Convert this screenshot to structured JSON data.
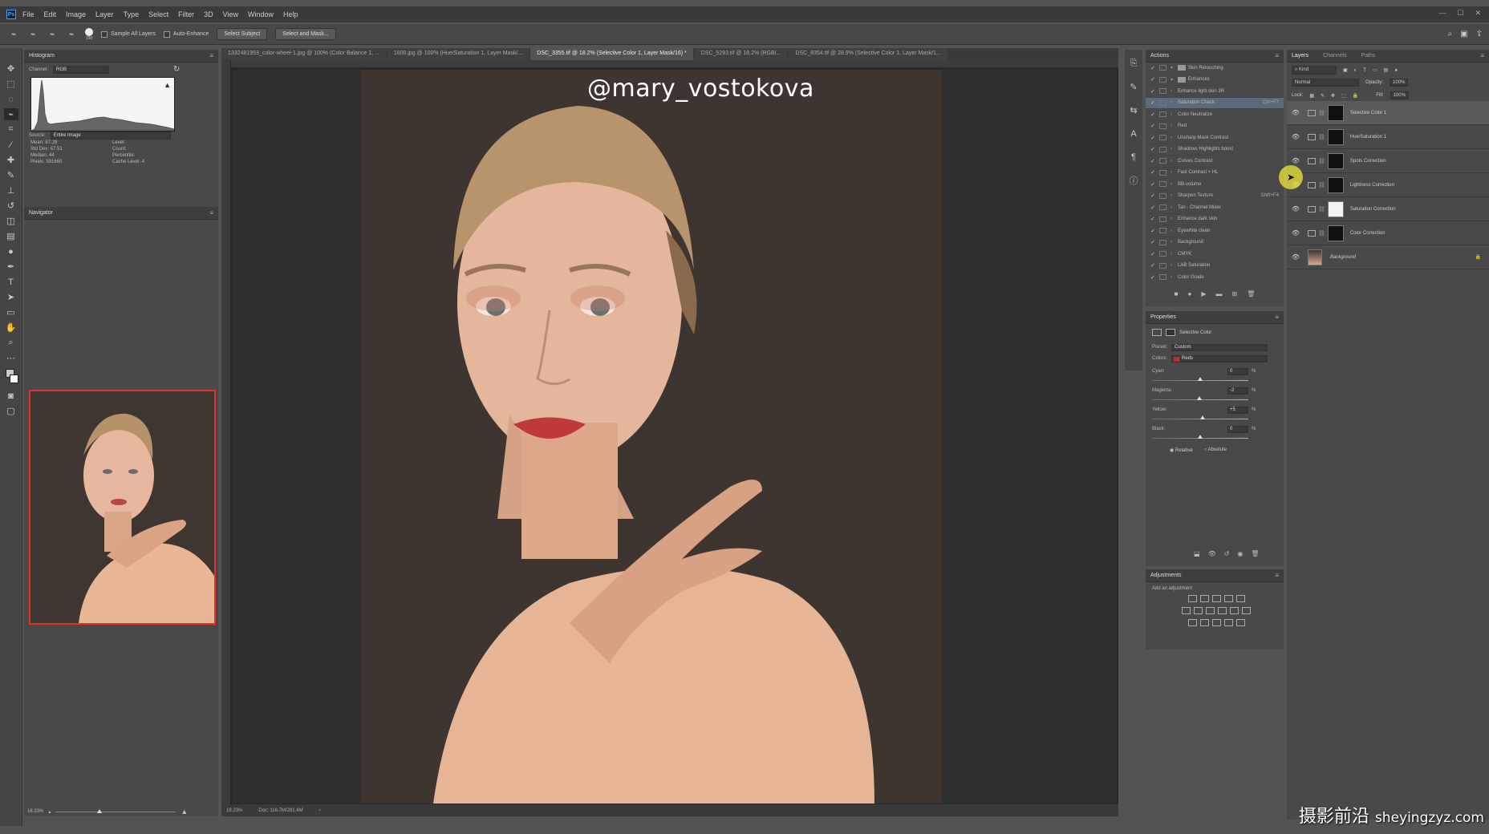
{
  "menubar": {
    "logo": "Ps",
    "items": [
      "File",
      "Edit",
      "Image",
      "Layer",
      "Type",
      "Select",
      "Filter",
      "3D",
      "View",
      "Window",
      "Help"
    ],
    "window_controls": [
      "—",
      "☐",
      "✕"
    ]
  },
  "options_bar": {
    "brush_size": "150",
    "sample_all_layers": "Sample All Layers",
    "auto_enhance": "Auto-Enhance",
    "select_subject": "Select Subject",
    "select_and_mask": "Select and Mask..."
  },
  "histogram": {
    "title": "Histogram",
    "channel_label": "Channel:",
    "channel_value": "RGB",
    "source_label": "Source:",
    "source_value": "Entire Image",
    "stats": [
      {
        "label": "Mean:",
        "value": "87.29"
      },
      {
        "label": "Std Dev:",
        "value": "67.51"
      },
      {
        "label": "Median:",
        "value": "44"
      },
      {
        "label": "Pixels:",
        "value": "591660"
      }
    ],
    "stats_right": [
      "Level:",
      "Count:",
      "Percentile:",
      "Cache Level: 4"
    ]
  },
  "navigator": {
    "title": "Navigator",
    "zoom": "18.23%"
  },
  "tabs": [
    {
      "label": "1332481953_color-wheel-1.jpg @ 100% (Color Balance 1, ...",
      "active": false
    },
    {
      "label": "1600.jpg @ 100% (Hue/Saturation 1, Layer Mask/...",
      "active": false
    },
    {
      "label": "DSC_3355.tif @ 18.2% (Selective Color 1, Layer Mask/16) *",
      "active": true
    },
    {
      "label": "DSC_5283.tif @ 18.2% (RGB/...",
      "active": false
    },
    {
      "label": "DSC_8354.tif @ 28.9% (Selective Color 1, Layer Mask/1...",
      "active": false
    }
  ],
  "canvas": {
    "watermark": "@mary_vostokova",
    "zoom": "18.23%",
    "doc_size": "Doc: 116.7M/281.4M"
  },
  "actions": {
    "title": "Actions",
    "items": [
      {
        "label": "Skin Retouching",
        "folder": true,
        "selected": false,
        "shortcut": ""
      },
      {
        "label": "Enhances",
        "folder": true,
        "selected": false,
        "shortcut": ""
      },
      {
        "label": "Enhance light skin 3R",
        "folder": false,
        "selected": false,
        "shortcut": ""
      },
      {
        "label": "Saturation Check",
        "folder": false,
        "selected": true,
        "shortcut": "Ctrl+F7"
      },
      {
        "label": "Color Neutralize",
        "folder": false,
        "selected": false,
        "shortcut": ""
      },
      {
        "label": "Red",
        "folder": false,
        "selected": false,
        "shortcut": ""
      },
      {
        "label": "Unsharp Mask Contrast",
        "folder": false,
        "selected": false,
        "shortcut": ""
      },
      {
        "label": "Shadows Highlights boost",
        "folder": false,
        "selected": false,
        "shortcut": ""
      },
      {
        "label": "Curves Contrast",
        "folder": false,
        "selected": false,
        "shortcut": ""
      },
      {
        "label": "Fast Contrast + HL",
        "folder": false,
        "selected": false,
        "shortcut": ""
      },
      {
        "label": "BB-volume",
        "folder": false,
        "selected": false,
        "shortcut": ""
      },
      {
        "label": "Sharpen Texture",
        "folder": false,
        "selected": false,
        "shortcut": "Shift+F4"
      },
      {
        "label": "Tan - Channel Mixer",
        "folder": false,
        "selected": false,
        "shortcut": ""
      },
      {
        "label": "Enhance dark skin",
        "folder": false,
        "selected": false,
        "shortcut": ""
      },
      {
        "label": "Eyewhite clean",
        "folder": false,
        "selected": false,
        "shortcut": ""
      },
      {
        "label": "Background",
        "folder": false,
        "selected": false,
        "shortcut": ""
      },
      {
        "label": "CMYK",
        "folder": false,
        "selected": false,
        "shortcut": ""
      },
      {
        "label": "LAB Saturation",
        "folder": false,
        "selected": false,
        "shortcut": ""
      },
      {
        "label": "Color Grade",
        "folder": false,
        "selected": false,
        "shortcut": ""
      }
    ]
  },
  "properties": {
    "title": "Properties",
    "adjustment_name": "Selective Color",
    "preset_label": "Preset:",
    "preset_value": "Custom",
    "colors_label": "Colors:",
    "colors_value": "Reds",
    "sliders": [
      {
        "label": "Cyan:",
        "value": "0",
        "unit": "%",
        "level": 0.5
      },
      {
        "label": "Magenta:",
        "value": "-2",
        "unit": "%",
        "level": 0.49
      },
      {
        "label": "Yellow:",
        "value": "+5",
        "unit": "%",
        "level": 0.525
      },
      {
        "label": "Black:",
        "value": "0",
        "unit": "%",
        "level": 0.5
      }
    ],
    "relative": "Relative",
    "absolute": "Absolute"
  },
  "adjustments": {
    "title": "Adjustments",
    "subtitle": "Add an adjustment"
  },
  "layers": {
    "tabs": [
      "Layers",
      "Channels",
      "Paths"
    ],
    "kind_label": "Kind",
    "blend_mode": "Normal",
    "opacity_label": "Opacity:",
    "opacity_value": "100%",
    "lock_label": "Lock:",
    "fill_label": "Fill:",
    "fill_value": "100%",
    "items": [
      {
        "name": "Selective Color 1",
        "selected": true,
        "mask": "dark"
      },
      {
        "name": "Hue/Saturation 1",
        "selected": false,
        "mask": "dark"
      },
      {
        "name": "Spots Correction",
        "selected": false,
        "mask": "dark"
      },
      {
        "name": "Lightness Correction",
        "selected": false,
        "mask": "dark"
      },
      {
        "name": "Saturation Correction",
        "selected": false,
        "mask": "white"
      },
      {
        "name": "Color Correction",
        "selected": false,
        "mask": "dark"
      },
      {
        "name": "Background",
        "selected": false,
        "mask": "photo"
      }
    ]
  },
  "site_watermark": {
    "cn": "摄影前沿",
    "url": "sheyingzyz.com"
  }
}
